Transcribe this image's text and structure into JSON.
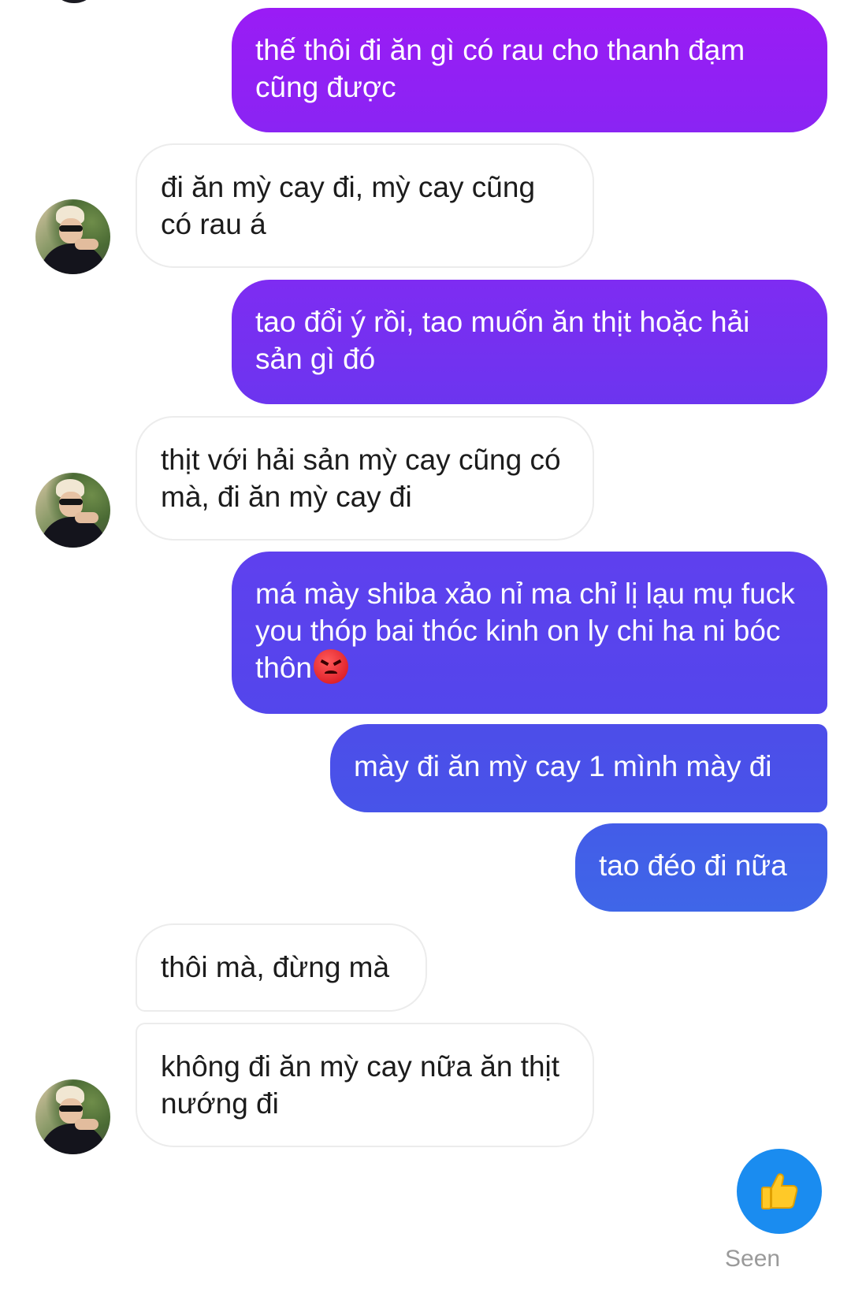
{
  "messages": [
    {
      "side": "out",
      "text": "thế thôi đi ăn gì có rau cho thanh đạm cũng được"
    },
    {
      "side": "in",
      "text": "đi ăn mỳ cay đi, mỳ cay cũng có rau á"
    },
    {
      "side": "out",
      "text": "tao đổi ý rồi, tao muốn ăn thịt hoặc hải sản gì đó"
    },
    {
      "side": "in",
      "text": "thịt với hải sản mỳ cay cũng có mà, đi ăn mỳ cay đi"
    },
    {
      "side": "out",
      "text": "má mày shiba xảo nỉ ma chỉ lị lạu mụ fuck you thóp bai thóc kinh on ly chi ha ni bóc thôn",
      "emoji": "angry-face-emoji"
    },
    {
      "side": "out",
      "text": "mày đi ăn mỳ cay 1 mình mày đi"
    },
    {
      "side": "out",
      "text": "tao đéo đi nữa"
    },
    {
      "side": "in",
      "text": "thôi mà, đừng mà"
    },
    {
      "side": "in",
      "text": "không đi ăn mỳ cay nữa ăn thịt nướng đi"
    }
  ],
  "footer": {
    "like_icon": "thumbs-up-icon",
    "seen_label": "Seen"
  },
  "colors": {
    "outgoing_top": "#9a1cf5",
    "outgoing_bottom": "#3d66e8",
    "incoming_bg": "#ffffff",
    "like_button": "#1a8cf0"
  }
}
